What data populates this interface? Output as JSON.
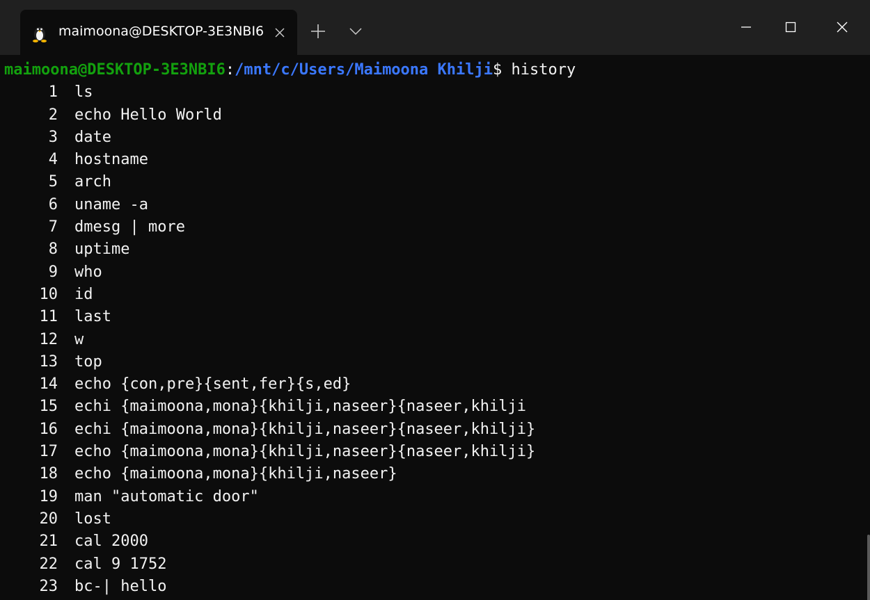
{
  "tab": {
    "title": "maimoona@DESKTOP-3E3NBI6",
    "icon": "linux-penguin-icon"
  },
  "controls": {
    "new_tab": "+",
    "minimize": "minimize",
    "maximize": "maximize",
    "close": "close"
  },
  "terminal": {
    "prompt_user": "maimoona@DESKTOP-3E3NBI6",
    "prompt_sep": ":",
    "prompt_path": "/mnt/c/Users/Maimoona Khilji",
    "prompt_symbol": "$",
    "command": " history",
    "history": [
      {
        "num": "1",
        "cmd": "ls"
      },
      {
        "num": "2",
        "cmd": "echo Hello World"
      },
      {
        "num": "3",
        "cmd": "date"
      },
      {
        "num": "4",
        "cmd": "hostname"
      },
      {
        "num": "5",
        "cmd": "arch"
      },
      {
        "num": "6",
        "cmd": "uname -a"
      },
      {
        "num": "7",
        "cmd": "dmesg | more"
      },
      {
        "num": "8",
        "cmd": "uptime"
      },
      {
        "num": "9",
        "cmd": "who"
      },
      {
        "num": "10",
        "cmd": "id"
      },
      {
        "num": "11",
        "cmd": "last"
      },
      {
        "num": "12",
        "cmd": "w"
      },
      {
        "num": "13",
        "cmd": "top"
      },
      {
        "num": "14",
        "cmd": "echo {con,pre}{sent,fer}{s,ed}"
      },
      {
        "num": "15",
        "cmd": "echi {maimoona,mona}{khilji,naseer}{naseer,khilji"
      },
      {
        "num": "16",
        "cmd": "echi {maimoona,mona}{khilji,naseer}{naseer,khilji}"
      },
      {
        "num": "17",
        "cmd": "echo {maimoona,mona}{khilji,naseer}{naseer,khilji}"
      },
      {
        "num": "18",
        "cmd": "echo {maimoona,mona}{khilji,naseer}"
      },
      {
        "num": "19",
        "cmd": "man \"automatic door\""
      },
      {
        "num": "20",
        "cmd": "lost"
      },
      {
        "num": "21",
        "cmd": "cal 2000"
      },
      {
        "num": "22",
        "cmd": "cal 9 1752"
      },
      {
        "num": "23",
        "cmd": "bc-| hello"
      }
    ]
  },
  "colors": {
    "user": "#13a10e",
    "path": "#3b78ff",
    "text": "#f2f2f2",
    "background": "#0c0c0c",
    "titlebar": "#202020"
  }
}
